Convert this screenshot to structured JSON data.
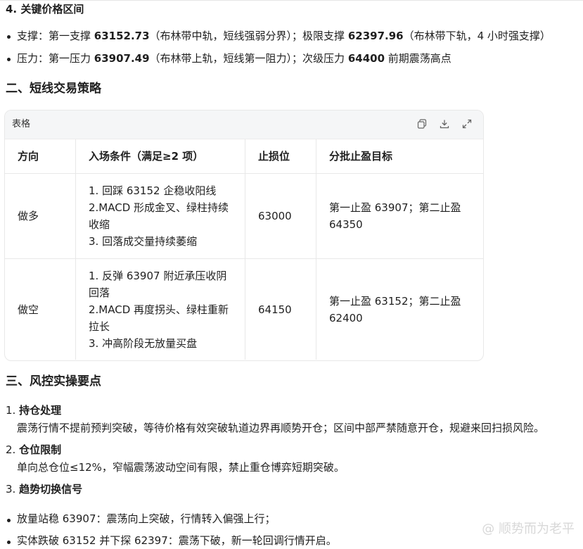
{
  "section4": {
    "heading": "4. 关键价格区间",
    "support": {
      "label": "支撑：第一支撑 ",
      "v1": "63152.73",
      "t1": "（布林带中轨，短线强弱分界）；极限支撑 ",
      "v2": "62397.96",
      "t2": "（布林带下轨，4 小时强支撑）"
    },
    "pressure": {
      "label": "压力：第一压力 ",
      "v1": "63907.49",
      "t1": "（布林带上轨，短线第一阻力）；次级压力 ",
      "v2": "64400",
      "t2": " 前期震荡高点"
    }
  },
  "section_strategy": {
    "heading": "二、短线交易策略"
  },
  "table": {
    "title": "表格",
    "icons": [
      "copy-icon",
      "download-icon",
      "expand-icon"
    ],
    "headers": [
      "方向",
      "入场条件（满足≥2 项）",
      "止损位",
      "分批止盈目标"
    ],
    "rows": [
      {
        "direction": "做多",
        "conditions": [
          "1. 回踩 63152 企稳收阳线",
          "2.MACD 形成金叉、绿柱持续收缩",
          "3. 回落成交量持续萎缩"
        ],
        "stop": "63000",
        "targets": "第一止盈 63907；第二止盈 64350"
      },
      {
        "direction": "做空",
        "conditions": [
          "1. 反弹 63907 附近承压收阴回落",
          "2.MACD 再度拐头、绿柱重新拉长",
          "3. 冲高阶段无放量买盘"
        ],
        "stop": "64150",
        "targets": "第一止盈 63152；第二止盈 62400"
      }
    ]
  },
  "section_risk": {
    "heading": "三、风控实操要点",
    "items": [
      {
        "num": "1.",
        "title": "持仓处理",
        "body": "震荡行情不提前预判突破，等待价格有效突破轨道边界再顺势开仓；区间中部严禁随意开仓，规避来回扫损风险。"
      },
      {
        "num": "2.",
        "title": "仓位限制",
        "body": "单向总仓位≤12%，窄幅震荡波动空间有限，禁止重仓博弈短期突破。"
      },
      {
        "num": "3.",
        "title": "趋势切换信号",
        "body": ""
      }
    ],
    "signals": [
      "放量站稳 63907：震荡向上突破，行情转入偏强上行；",
      "实体跌破 63152 并下探 62397：震荡下破，新一轮回调行情开启。"
    ]
  },
  "watermark": "@ 顺势而为老平"
}
